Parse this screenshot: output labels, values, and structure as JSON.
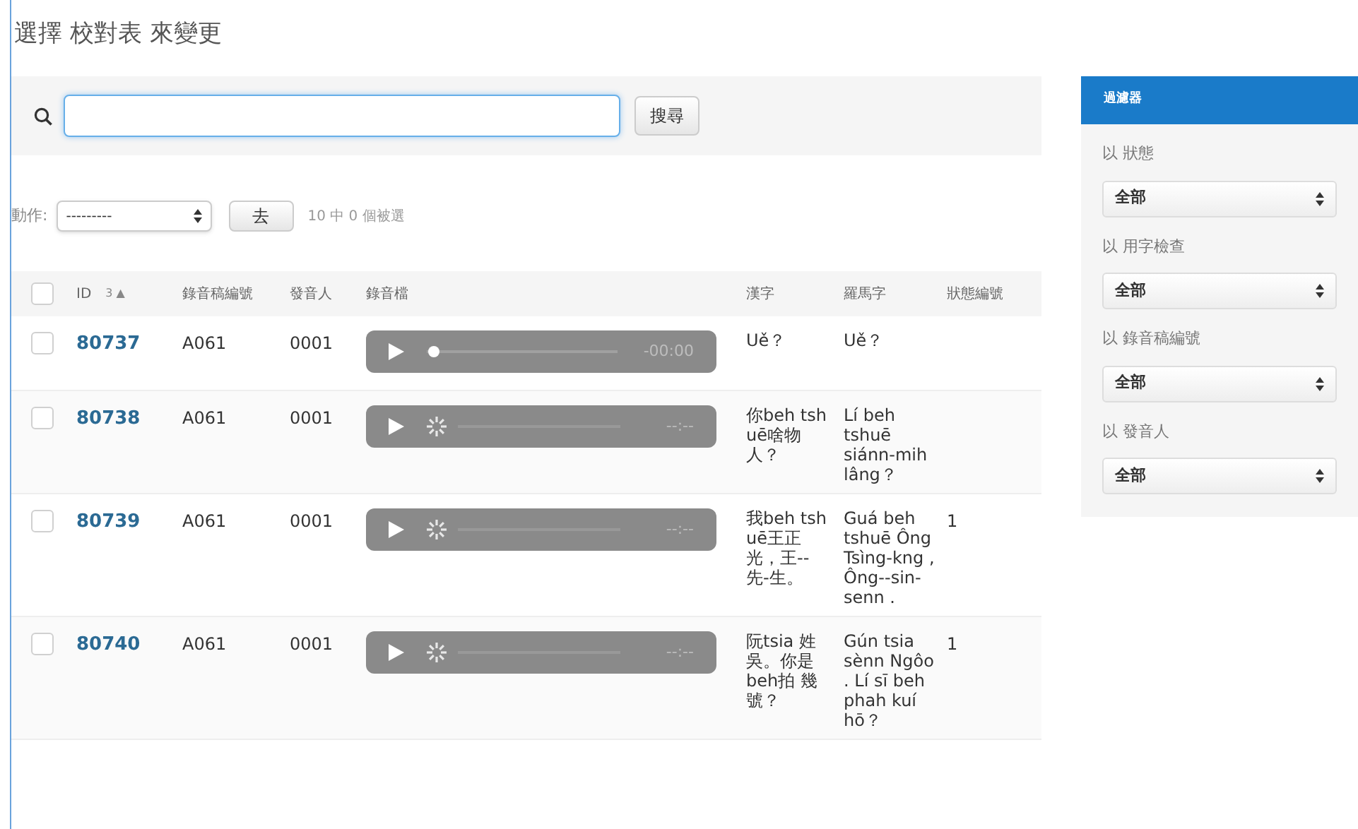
{
  "title": "選擇 校對表 來變更",
  "search": {
    "button": "搜尋"
  },
  "actions": {
    "label": "動作:",
    "select": "---------",
    "go": "去",
    "counter": "10 中 0 個被選"
  },
  "table": {
    "all_checked": false,
    "columns": [
      {
        "label": "ID",
        "sort_rank": "3",
        "sort_arrow": "▲"
      },
      {
        "label": "錄音稿編號"
      },
      {
        "label": "發音人"
      },
      {
        "label": "錄音檔"
      },
      {
        "label": "漢字"
      },
      {
        "label": "羅馬字"
      },
      {
        "label": "狀態編號"
      }
    ],
    "rows": [
      {
        "checked": false,
        "id": "80737",
        "script": "A061",
        "speaker": "0001",
        "audio": {
          "kind": "ready",
          "time": "-00:00"
        },
        "hanzi": "Uě？",
        "roman": "Uě？"
      },
      {
        "checked": false,
        "id": "80738",
        "script": "A061",
        "speaker": "0001",
        "audio": {
          "kind": "loading",
          "time": "--:--"
        },
        "hanzi": "你beh tshuē啥物人？",
        "roman": "Lí beh tshuē siánn-mih lâng？"
      },
      {
        "checked": false,
        "id": "80739",
        "script": "A061",
        "speaker": "0001",
        "audio": {
          "kind": "loading",
          "time": "--:--"
        },
        "hanzi": "我beh tshuē王正光，王--先-生。",
        "roman": "Guá beh tshuē Ông Tsìng-kng , Ông--sin-senn .",
        "status": "1"
      },
      {
        "checked": false,
        "id": "80740",
        "script": "A061",
        "speaker": "0001",
        "audio": {
          "kind": "loading",
          "time": "--:--"
        },
        "hanzi": "阮tsia 姓吳。你是 beh拍 幾號？",
        "roman": "Gún tsia sènn Ngôo . Lí sī beh phah kuí hō？",
        "status": "1"
      }
    ]
  },
  "filter": {
    "title": "過濾器",
    "groups": [
      {
        "label": "以 狀態",
        "value": "全部"
      },
      {
        "label": "以 用字檢查",
        "value": "全部"
      },
      {
        "label": "以 錄音稿編號",
        "value": "全部"
      },
      {
        "label": "以 發音人",
        "value": "全部"
      }
    ]
  }
}
